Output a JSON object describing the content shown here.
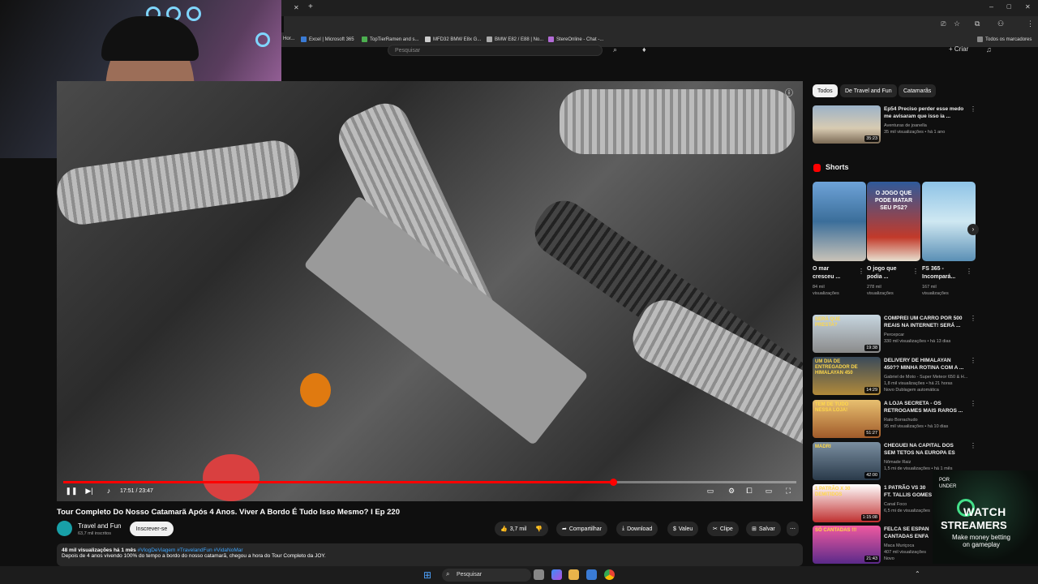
{
  "bookmarks": [
    {
      "label": "Hor..."
    },
    {
      "label": "Excel | Microsoft 365"
    },
    {
      "label": "TopTierRamen and s..."
    },
    {
      "label": "MFD32 BMW E8x G..."
    },
    {
      "label": "BMW E82 / E88 | No..."
    },
    {
      "label": "StereOnline - Chat -..."
    },
    {
      "label": "Todos os marcadores"
    }
  ],
  "header": {
    "search_placeholder": "Pesquisar",
    "create_label": "+ Criar"
  },
  "player": {
    "time": "17:51 / 23:47",
    "progress": 0.75
  },
  "video": {
    "title": "Tour Completo Do Nosso Catamarã Após 4 Anos. Viver A Bordo É Tudo Isso Mesmo? I Ep 220",
    "channel": "Travel and Fun",
    "subscribers": "63,7 mil inscritos",
    "subscribe": "Inscrever-se",
    "likes": "3,7 mil",
    "share": "Compartilhar",
    "download": "Download",
    "thanks": "Valeu",
    "clip": "Clipe",
    "save": "Salvar",
    "meta": "48 mil visualizações  há 1 mês",
    "tags": "#VlogDeViagem #TravelandFun #VidaNoMar",
    "description": "Depois de 4 anos vivendo 100% do tempo a bordo do nosso catamarã, chegou a hora do Tour Completo da JOY."
  },
  "chips": [
    "Todos",
    "De Travel and Fun",
    "Catamarãs"
  ],
  "top_video": {
    "title1": "Ep54 Preciso perder esse medo",
    "title2": "me avisaram que isso ia ...",
    "channel": "Aventuras de joanella",
    "views": "35 mil visualizações • há 1 ano",
    "duration": "35:23"
  },
  "shorts_title": "Shorts",
  "shorts": [
    {
      "title1": "O mar",
      "title2": "cresceu ...",
      "views1": "84 mil",
      "views2": "visualizações"
    },
    {
      "title1": "O jogo que",
      "title2": "podia ...",
      "views1": "278 mil",
      "views2": "visualizações"
    },
    {
      "title1": "FS 365 -",
      "title2": "Incompará...",
      "views1": "167 mil",
      "views2": "visualizações"
    }
  ],
  "short_thumb_text": "O JOGO QUE PODE MATAR SEU PS2?",
  "recs": [
    {
      "title1": "COMPREI UM CARRO POR 500",
      "title2": "REAIS NA INTERNET! SERÁ ...",
      "channel": "Percepcar",
      "views": "330 mil visualizações • há 13 dias",
      "extra": "",
      "duration": "19:38",
      "thumb_text": "SERÁ QUE PRESTA?"
    },
    {
      "title1": "DELIVERY DE HIMALAYAN",
      "title2": "450?? MINHA ROTINA COM A ...",
      "channel": "Gabriel de Moto - Super Meteor 650 & H...",
      "views": "1,8 mil visualizações • há 21 horas",
      "extra": "Novo  Dublagem automática",
      "duration": "14:29",
      "thumb_text": "UM DIA DE ENTREGADOR DE HIMALAYAN 450"
    },
    {
      "title1": "A LOJA SECRETA - OS",
      "title2": "RETROGAMES MAIS RAROS ...",
      "channel": "Rato Borrachudo",
      "views": "95 mil visualizações • há 10 dias",
      "extra": "",
      "duration": "51:27",
      "thumb_text": "TEM DE TUDO NESSA LOJA!"
    },
    {
      "title1": "CHEGUEI NA CAPITAL DOS",
      "title2": "SEM TETOS NA EUROPA ES",
      "channel": "Nômade Raiz",
      "views": "1,5 mi de visualizações • há 1 mês",
      "extra": "",
      "duration": "42:00",
      "thumb_text": "MADRI"
    },
    {
      "title1": "1 PATRÃO VS 30",
      "title2": "FT. TALLIS GOMES",
      "channel": "Canal Foco",
      "views": "6,5 mi de visualizações",
      "extra": "",
      "duration": "1:15:08",
      "thumb_text": "1 PATRÃO X 30 DEMITIDOS"
    },
    {
      "title1": "FELCA SE ESPAN",
      "title2": "CANTADAS ENFA",
      "channel": "Maca Muriçoca",
      "views": "407 mil visualizações",
      "extra": "Novo",
      "duration": "21:43",
      "thumb_text": "SÓ CANTADAS !!!"
    }
  ],
  "overlay": {
    "brand1": "WATCH",
    "brand2": "STREAMERS",
    "tagline": "Make money betting on gameplay",
    "badge": "POR UNDER"
  },
  "taskbar": {
    "search": "Pesquisar"
  },
  "colors": {
    "accent": "#ff0000",
    "link": "#3ea6ff",
    "bg": "#0f0f0f"
  }
}
